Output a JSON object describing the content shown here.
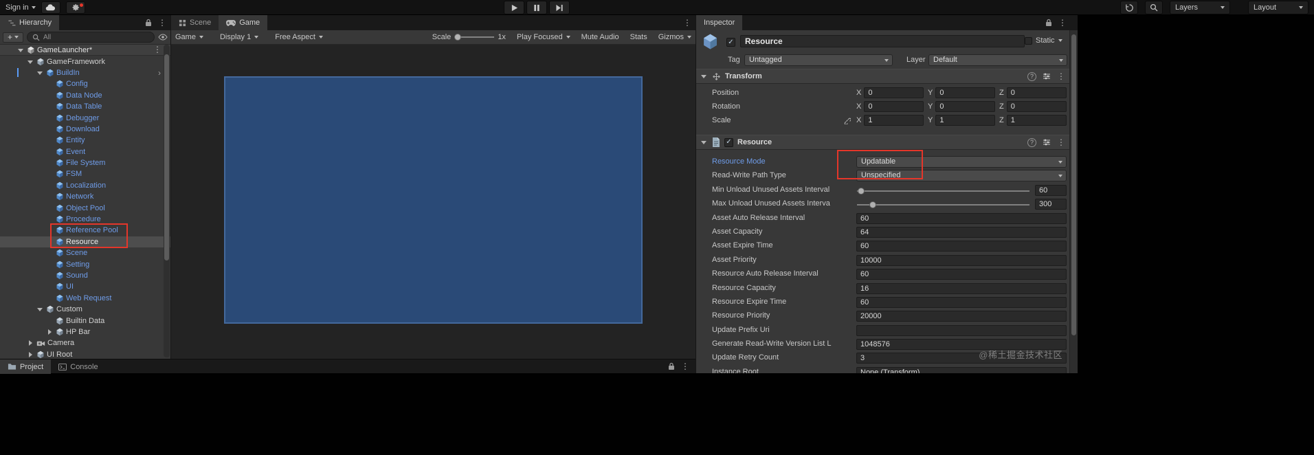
{
  "colors": {
    "annotation_red": "#e5362a",
    "prefab_blue": "#6f9ce8",
    "selection_gray": "#4d4d4d",
    "game_rect_fill": "#2a4a77",
    "game_rect_border": "#44699c",
    "check_blue": "#c3d6e8"
  },
  "icons": {
    "add": "+",
    "kebab": "⋮",
    "help": "?",
    "prefab_chevron": "›",
    "check": "✓"
  },
  "topbar": {
    "sign_in": "Sign in",
    "layers": "Layers",
    "layout": "Layout"
  },
  "hierarchy": {
    "tab": "Hierarchy",
    "search_filter": "All",
    "rows": [
      {
        "label": "GameLauncher*",
        "depth": 0,
        "fold": "open",
        "icon": "scene",
        "style": "scene",
        "menu": true
      },
      {
        "label": "GameFramework",
        "depth": 1,
        "fold": "open",
        "icon": "cube-gray",
        "style": "normal"
      },
      {
        "label": "BuildIn",
        "depth": 2,
        "fold": "open",
        "icon": "cube-blue",
        "style": "prefab",
        "chevron": true
      },
      {
        "label": "Config",
        "depth": 3,
        "icon": "cube-blue",
        "style": "prefab"
      },
      {
        "label": "Data Node",
        "depth": 3,
        "icon": "cube-blue",
        "style": "prefab"
      },
      {
        "label": "Data Table",
        "depth": 3,
        "icon": "cube-blue",
        "style": "prefab"
      },
      {
        "label": "Debugger",
        "depth": 3,
        "icon": "cube-blue",
        "style": "prefab"
      },
      {
        "label": "Download",
        "depth": 3,
        "icon": "cube-blue",
        "style": "prefab"
      },
      {
        "label": "Entity",
        "depth": 3,
        "icon": "cube-blue",
        "style": "prefab"
      },
      {
        "label": "Event",
        "depth": 3,
        "icon": "cube-blue",
        "style": "prefab"
      },
      {
        "label": "File System",
        "depth": 3,
        "icon": "cube-blue",
        "style": "prefab"
      },
      {
        "label": "FSM",
        "depth": 3,
        "icon": "cube-blue",
        "style": "prefab"
      },
      {
        "label": "Localization",
        "depth": 3,
        "icon": "cube-blue",
        "style": "prefab"
      },
      {
        "label": "Network",
        "depth": 3,
        "icon": "cube-blue",
        "style": "prefab"
      },
      {
        "label": "Object Pool",
        "depth": 3,
        "icon": "cube-blue",
        "style": "prefab"
      },
      {
        "label": "Procedure",
        "depth": 3,
        "icon": "cube-blue",
        "style": "prefab"
      },
      {
        "label": "Reference Pool",
        "depth": 3,
        "icon": "cube-blue",
        "style": "prefab"
      },
      {
        "label": "Resource",
        "depth": 3,
        "icon": "cube-blue",
        "style": "prefab",
        "selected": true
      },
      {
        "label": "Scene",
        "depth": 3,
        "icon": "cube-blue",
        "style": "prefab"
      },
      {
        "label": "Setting",
        "depth": 3,
        "icon": "cube-blue",
        "style": "prefab"
      },
      {
        "label": "Sound",
        "depth": 3,
        "icon": "cube-blue",
        "style": "prefab"
      },
      {
        "label": "UI",
        "depth": 3,
        "icon": "cube-blue",
        "style": "prefab"
      },
      {
        "label": "Web Request",
        "depth": 3,
        "icon": "cube-blue",
        "style": "prefab"
      },
      {
        "label": "Custom",
        "depth": 2,
        "fold": "open",
        "icon": "cube-gray",
        "style": "normal"
      },
      {
        "label": "Builtin Data",
        "depth": 3,
        "icon": "cube-gray",
        "style": "normal"
      },
      {
        "label": "HP Bar",
        "depth": 3,
        "fold": "closed",
        "icon": "cube-gray",
        "style": "normal"
      },
      {
        "label": "Camera",
        "depth": 1,
        "fold": "closed",
        "icon": "camera",
        "style": "normal"
      },
      {
        "label": "UI Root",
        "depth": 1,
        "fold": "closed",
        "icon": "cube-gray",
        "style": "normal"
      }
    ]
  },
  "game_view": {
    "scene_tab": "Scene",
    "game_tab": "Game",
    "toolbar": {
      "target": "Game",
      "display": "Display 1",
      "aspect": "Free Aspect",
      "scale_label": "Scale",
      "scale_value": "1x",
      "focus": "Play Focused",
      "mute": "Mute Audio",
      "stats": "Stats",
      "gizmos": "Gizmos"
    }
  },
  "bottom_tabs": {
    "project": "Project",
    "console": "Console"
  },
  "inspector": {
    "tab": "Inspector",
    "header": {
      "name": "Resource",
      "static_label": "Static",
      "tag_label": "Tag",
      "tag_value": "Untagged",
      "layer_label": "Layer",
      "layer_value": "Default"
    },
    "transform": {
      "title": "Transform",
      "axes": [
        "X",
        "Y",
        "Z"
      ],
      "rows": [
        {
          "label": "Position",
          "values": [
            "0",
            "0",
            "0"
          ]
        },
        {
          "label": "Rotation",
          "values": [
            "0",
            "0",
            "0"
          ]
        },
        {
          "label": "Scale",
          "values": [
            "1",
            "1",
            "1"
          ],
          "linked": true
        }
      ]
    },
    "resource_component": {
      "title": "Resource",
      "props": [
        {
          "label": "Resource Mode",
          "type": "dropdown",
          "value": "Updatable",
          "blue": true
        },
        {
          "label": "Read-Write Path Type",
          "type": "dropdown",
          "value": "Unspecified"
        },
        {
          "label": "Min Unload Unused Assets Interval",
          "type": "slider",
          "value": "60",
          "knob": 0.01
        },
        {
          "label": "Max Unload Unused Assets Interva",
          "type": "slider",
          "value": "300",
          "knob": 0.08
        },
        {
          "label": "Asset Auto Release Interval",
          "type": "field",
          "value": "60"
        },
        {
          "label": "Asset Capacity",
          "type": "field",
          "value": "64"
        },
        {
          "label": "Asset Expire Time",
          "type": "field",
          "value": "60"
        },
        {
          "label": "Asset Priority",
          "type": "field",
          "value": "10000"
        },
        {
          "label": "Resource Auto Release Interval",
          "type": "field",
          "value": "60"
        },
        {
          "label": "Resource Capacity",
          "type": "field",
          "value": "16"
        },
        {
          "label": "Resource Expire Time",
          "type": "field",
          "value": "60"
        },
        {
          "label": "Resource Priority",
          "type": "field",
          "value": "20000"
        },
        {
          "label": "Update Prefix Uri",
          "type": "field",
          "value": ""
        },
        {
          "label": "Generate Read-Write Version List L",
          "type": "field",
          "value": "1048576"
        },
        {
          "label": "Update Retry Count",
          "type": "field",
          "value": "3"
        },
        {
          "label": "Instance Root",
          "type": "field",
          "value": "None (Transform)"
        }
      ]
    }
  },
  "watermark": "@稀土掘金技术社区"
}
